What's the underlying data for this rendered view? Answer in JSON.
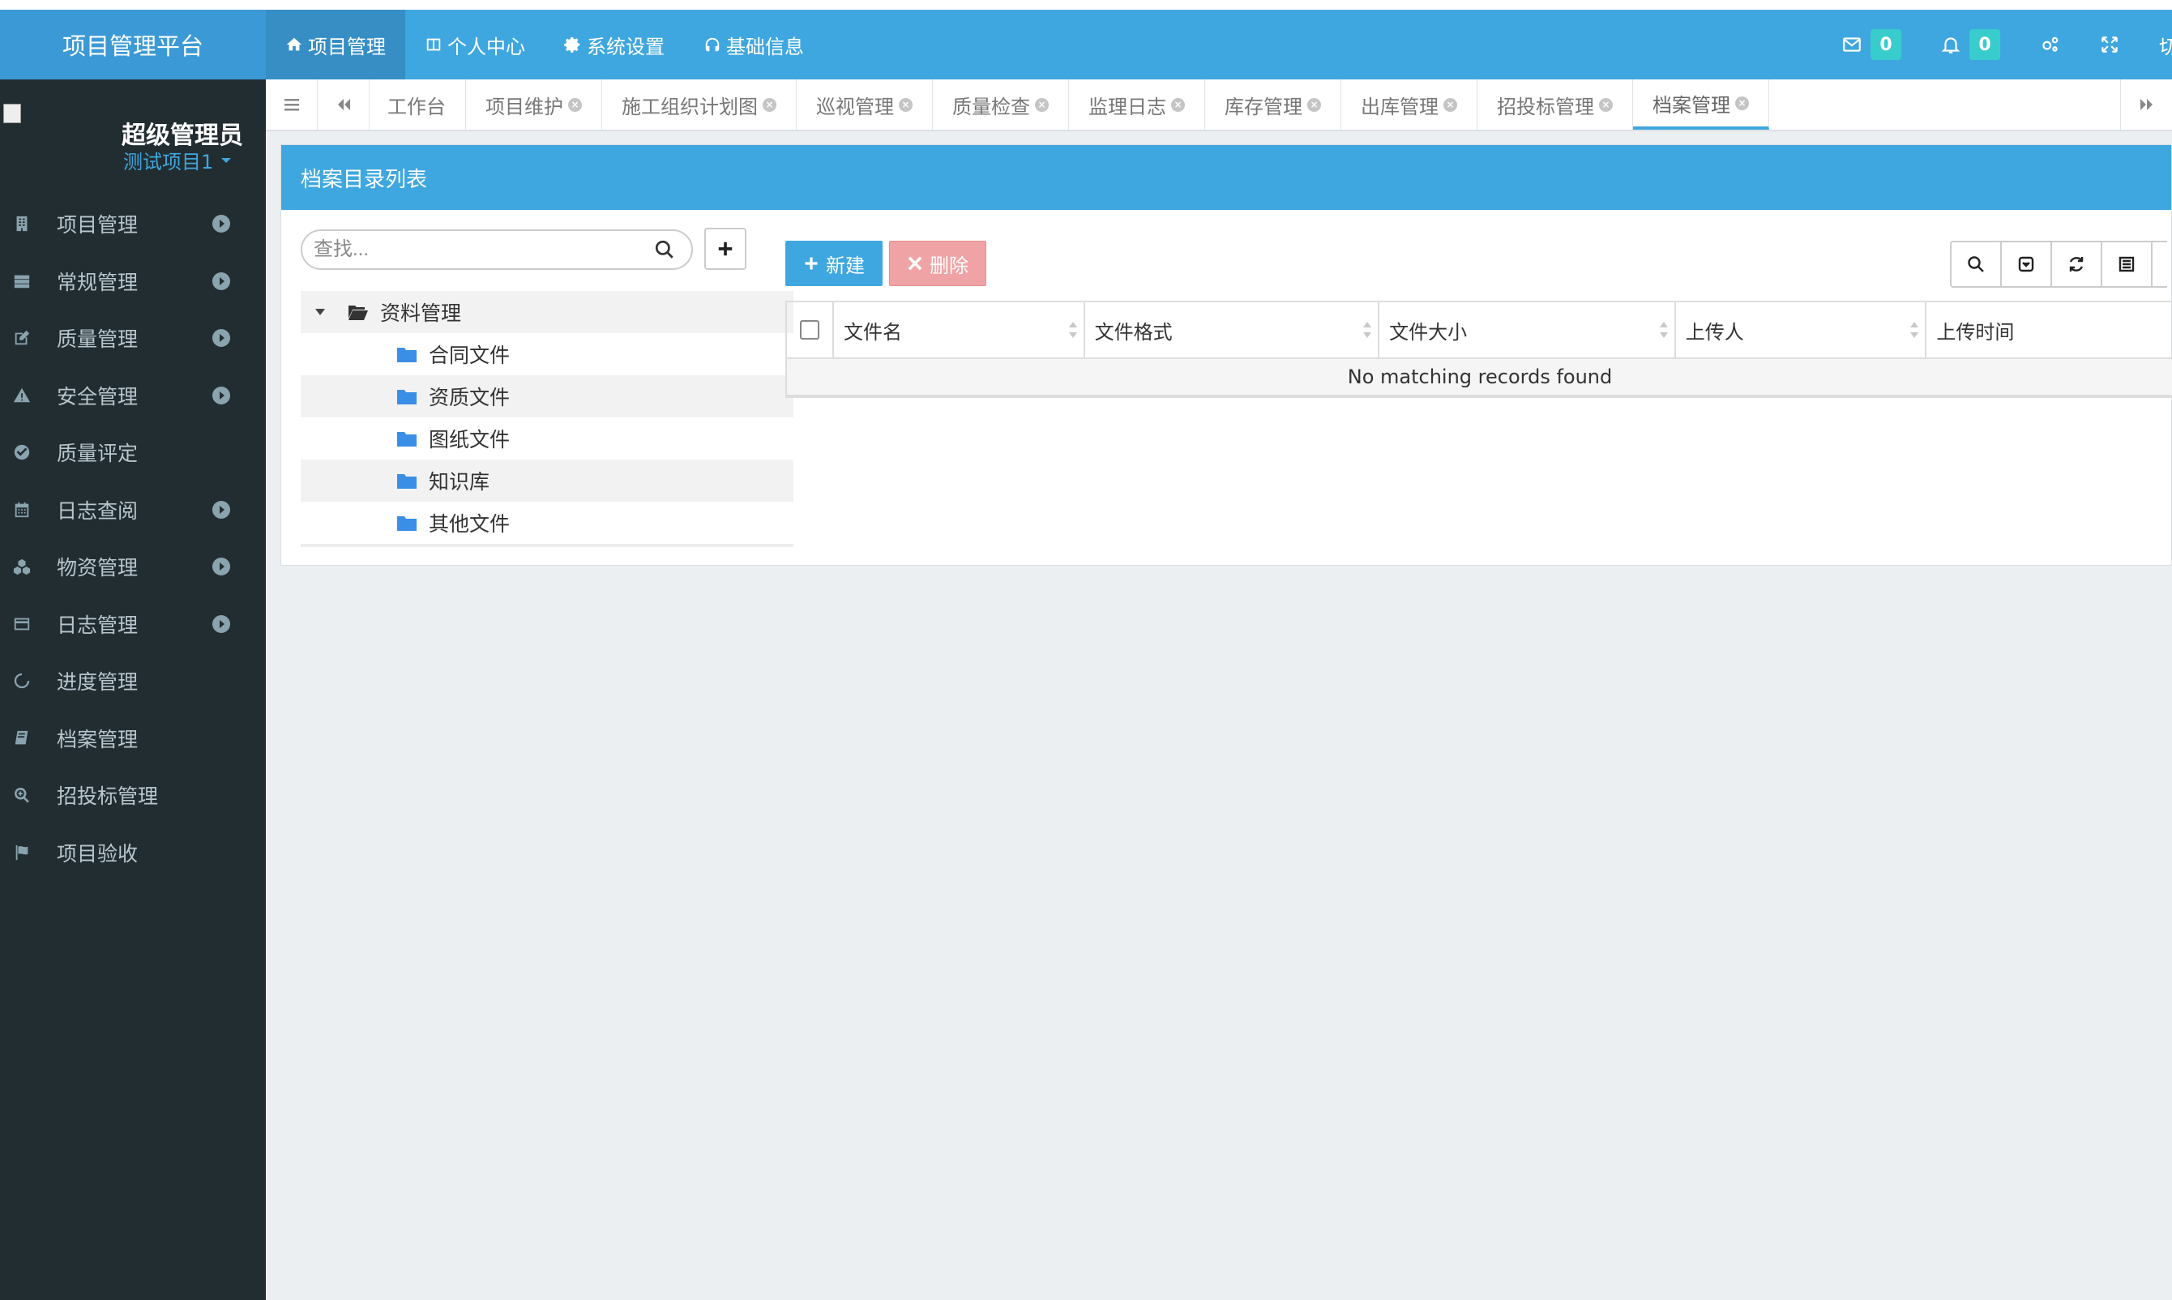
{
  "brand": "项目管理平台",
  "topnav": [
    {
      "label": "项目管理",
      "icon": "home-icon",
      "active": true
    },
    {
      "label": "个人中心",
      "icon": "columns-icon",
      "active": false
    },
    {
      "label": "系统设置",
      "icon": "gear-icon",
      "active": false
    },
    {
      "label": "基础信息",
      "icon": "headset-icon",
      "active": false
    }
  ],
  "header_right": {
    "mail_count": "0",
    "bell_count": "0",
    "switch_label": "切"
  },
  "user": {
    "name": "超级管理员",
    "project": "测试项目1"
  },
  "sidebar": {
    "items": [
      {
        "label": "项目管理",
        "icon": "building-icon",
        "has_children": true
      },
      {
        "label": "常规管理",
        "icon": "server-icon",
        "has_children": true
      },
      {
        "label": "质量管理",
        "icon": "edit-icon",
        "has_children": true
      },
      {
        "label": "安全管理",
        "icon": "warning-icon",
        "has_children": true
      },
      {
        "label": "质量评定",
        "icon": "check-circle-icon",
        "has_children": false
      },
      {
        "label": "日志查阅",
        "icon": "calendar-icon",
        "has_children": true
      },
      {
        "label": "物资管理",
        "icon": "cubes-icon",
        "has_children": true
      },
      {
        "label": "日志管理",
        "icon": "credit-card-icon",
        "has_children": true
      },
      {
        "label": "进度管理",
        "icon": "spinner-icon",
        "has_children": false
      },
      {
        "label": "档案管理",
        "icon": "book-icon",
        "has_children": false
      },
      {
        "label": "招投标管理",
        "icon": "search-plus-icon",
        "has_children": false
      },
      {
        "label": "项目验收",
        "icon": "flag-icon",
        "has_children": false
      }
    ]
  },
  "tabs": [
    {
      "label": "工作台",
      "closable": false
    },
    {
      "label": "项目维护",
      "closable": true
    },
    {
      "label": "施工组织计划图",
      "closable": true
    },
    {
      "label": "巡视管理",
      "closable": true
    },
    {
      "label": "质量检查",
      "closable": true
    },
    {
      "label": "监理日志",
      "closable": true
    },
    {
      "label": "库存管理",
      "closable": true
    },
    {
      "label": "出库管理",
      "closable": true
    },
    {
      "label": "招投标管理",
      "closable": true
    },
    {
      "label": "档案管理",
      "closable": true,
      "active": true
    }
  ],
  "panel": {
    "title": "档案目录列表",
    "search_placeholder": "查找..."
  },
  "tree": {
    "root": "资料管理",
    "children": [
      "合同文件",
      "资质文件",
      "图纸文件",
      "知识库",
      "其他文件"
    ]
  },
  "actions": {
    "new_label": "新建",
    "delete_label": "删除"
  },
  "table": {
    "columns": [
      "文件名",
      "文件格式",
      "文件大小",
      "上传人",
      "上传时间"
    ],
    "empty_text": "No matching records found"
  },
  "colors": {
    "primary": "#3fa7df",
    "sidebar_bg": "#222d32",
    "danger_disabled": "#f0a3a5",
    "badge": "#39cccc"
  }
}
